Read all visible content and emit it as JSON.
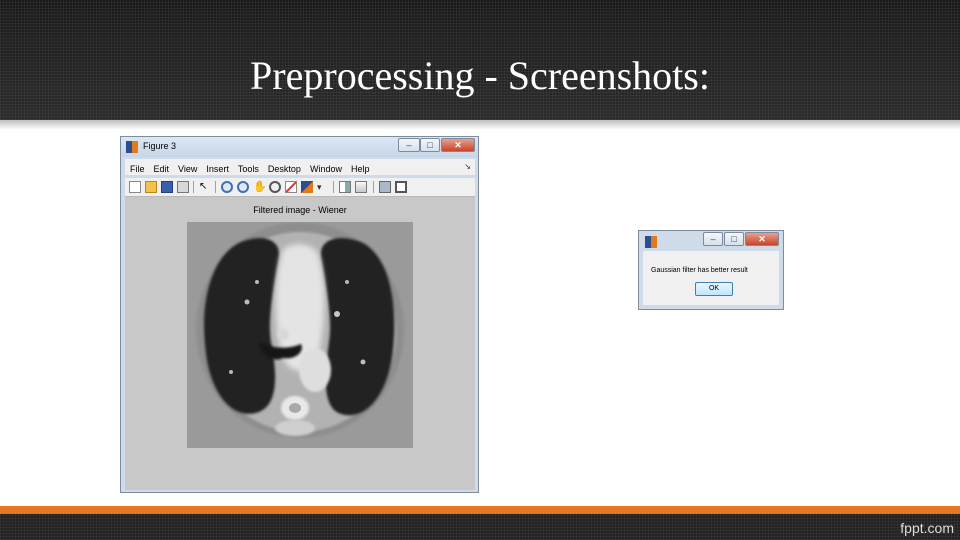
{
  "slide": {
    "title": "Preprocessing - Screenshots:",
    "footer_logo": "fppt.com"
  },
  "figure_window": {
    "title": "Figure 3",
    "menu": [
      "File",
      "Edit",
      "View",
      "Insert",
      "Tools",
      "Desktop",
      "Window",
      "Help"
    ],
    "axes_title": "Filtered image - Wiener",
    "toolbar_icons": [
      "new-figure-icon",
      "open-file-icon",
      "save-icon",
      "print-icon",
      "pointer-icon",
      "zoom-in-icon",
      "zoom-out-icon",
      "pan-icon",
      "rotate-3d-icon",
      "data-cursor-icon",
      "brush-icon",
      "link-icon",
      "colorbar-icon",
      "legend-icon",
      "hide-plot-tools-icon",
      "show-plot-tools-icon"
    ]
  },
  "dialog": {
    "message": "Gaussian filter has better result",
    "ok_label": "OK"
  },
  "colors": {
    "accent_orange": "#e87722",
    "matlab_blue": "#2b4e92",
    "matlab_orange": "#e07a1c"
  }
}
